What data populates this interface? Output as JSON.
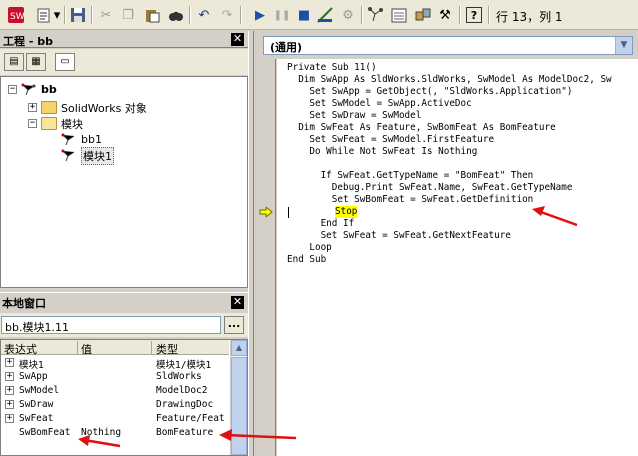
{
  "toolbar": {
    "cursor_position": "行 13，列 1"
  },
  "project_panel": {
    "title": "工程 - bb",
    "tree": [
      {
        "label": "bb",
        "level": 0
      },
      {
        "label": "SolidWorks 对象",
        "level": 1
      },
      {
        "label": "模块",
        "level": 1
      },
      {
        "label": "bb1",
        "level": 2
      },
      {
        "label": "模块1",
        "level": 2
      }
    ]
  },
  "locals_panel": {
    "title": "本地窗口",
    "context": "bb.模块1.11",
    "context_button": "...",
    "columns": [
      "表达式",
      "值",
      "类型"
    ],
    "rows": [
      {
        "expr": "模块1",
        "value": "",
        "type": "模块1/模块1"
      },
      {
        "expr": "SwApp",
        "value": "",
        "type": "SldWorks"
      },
      {
        "expr": "SwModel",
        "value": "",
        "type": "ModelDoc2"
      },
      {
        "expr": "SwDraw",
        "value": "",
        "type": "DrawingDoc"
      },
      {
        "expr": "SwFeat",
        "value": "",
        "type": "Feature/Feat"
      },
      {
        "expr": "SwBomFeat",
        "value": "Nothing",
        "type": "BomFeature"
      }
    ]
  },
  "code_window": {
    "object_combo": "(通用)",
    "lines": [
      "Private Sub 11()",
      "  Dim SwApp As SldWorks.SldWorks, SwModel As ModelDoc2, Sw",
      "    Set SwApp = GetObject(, \"SldWorks.Application\")",
      "    Set SwModel = SwApp.ActiveDoc",
      "    Set SwDraw = SwModel",
      "  Dim SwFeat As Feature, SwBomFeat As BomFeature",
      "    Set SwFeat = SwModel.FirstFeature",
      "    Do While Not SwFeat Is Nothing",
      "",
      "      If SwFeat.GetTypeName = \"BomFeat\" Then",
      "        Debug.Print SwFeat.Name, SwFeat.GetTypeName",
      "        Set SwBomFeat = SwFeat.GetDefinition",
      "        Stop",
      "      End If",
      "      Set SwFeat = SwFeat.GetNextFeature",
      "    Loop",
      "End Sub"
    ]
  },
  "colors": {
    "annotation_arrow": "#e01010",
    "execution_arrow": "#ffff00"
  }
}
